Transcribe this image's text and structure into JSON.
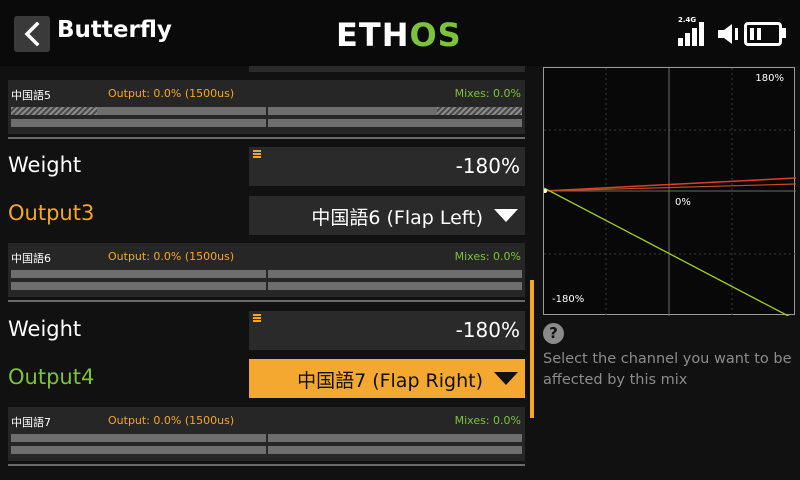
{
  "header": {
    "title": "Butterfly",
    "logo_part1": "ETH",
    "logo_part2": "OS",
    "radio_band": "2.4G",
    "icons": [
      "back-arrow-icon",
      "signal-icon",
      "speaker-icon",
      "battery-icon"
    ]
  },
  "rows": [
    {
      "channel_info": {
        "channel": "中国語5",
        "output": "Output: 0.0% (1500us)",
        "mixes": "Mixes: 0.0%"
      }
    },
    {
      "weight_label": "Weight",
      "weight_value": "-180%",
      "output_label": "Output3",
      "output_value": "中国語6 (Flap Left)",
      "channel_info": {
        "channel": "中国語6",
        "output": "Output: 0.0% (1500us)",
        "mixes": "Mixes: 0.0%"
      }
    },
    {
      "weight_label": "Weight",
      "weight_value": "-180%",
      "output_label": "Output4",
      "output_value": "中国語7 (Flap Right)",
      "channel_info": {
        "channel": "中国語7",
        "output": "Output: 0.0% (1500us)",
        "mixes": "Mixes: 0.0%"
      }
    }
  ],
  "graph": {
    "top_label": "180%",
    "mid_label": "0%",
    "bottom_label": "-180%"
  },
  "help": {
    "icon": "question-icon",
    "text_line1": "Select the channel you want to be",
    "text_line2": "affected by this mix"
  },
  "colors": {
    "accent": "#f5a623",
    "green": "#7cc23a",
    "background": "#111111",
    "curve_line": "#a6d21a",
    "curve_red": "#e04020"
  }
}
